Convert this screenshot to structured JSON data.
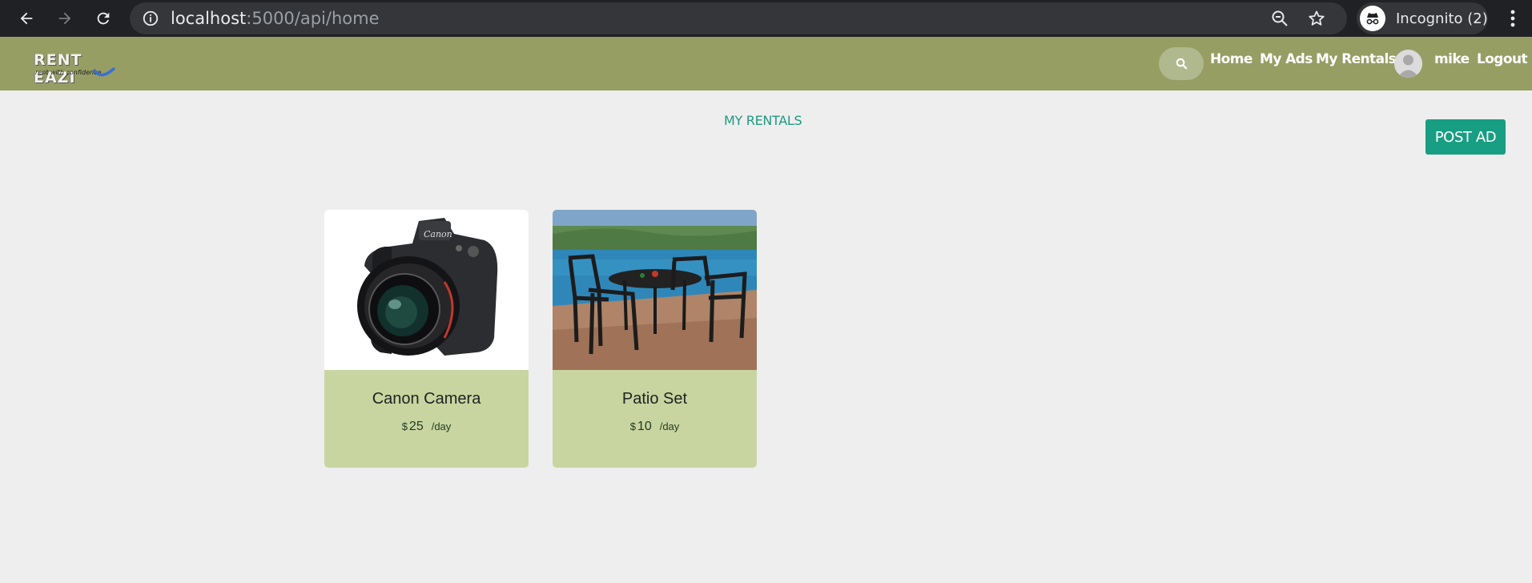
{
  "browser": {
    "url_host": "localhost",
    "url_rest": ":5000/api/home",
    "profile_label": "Incognito (2)"
  },
  "header": {
    "logo_title": "RENT EAZI",
    "logo_tagline": "rent with confidence",
    "nav": {
      "home": "Home",
      "my_ads": "My Ads",
      "my_rentals": "My Rentals",
      "username": "mike",
      "logout": "Logout"
    }
  },
  "main": {
    "title": "MY RENTALS",
    "post_ad_label": "POST AD",
    "cards": [
      {
        "title": "Canon Camera",
        "currency": "$",
        "price": "25",
        "period": "/day"
      },
      {
        "title": "Patio Set",
        "currency": "$",
        "price": "10",
        "period": "/day"
      }
    ]
  },
  "colors": {
    "header_bg": "#979e64",
    "accent": "#189e82",
    "card_bg": "#c8d5a0",
    "page_bg": "#eeeeee"
  }
}
